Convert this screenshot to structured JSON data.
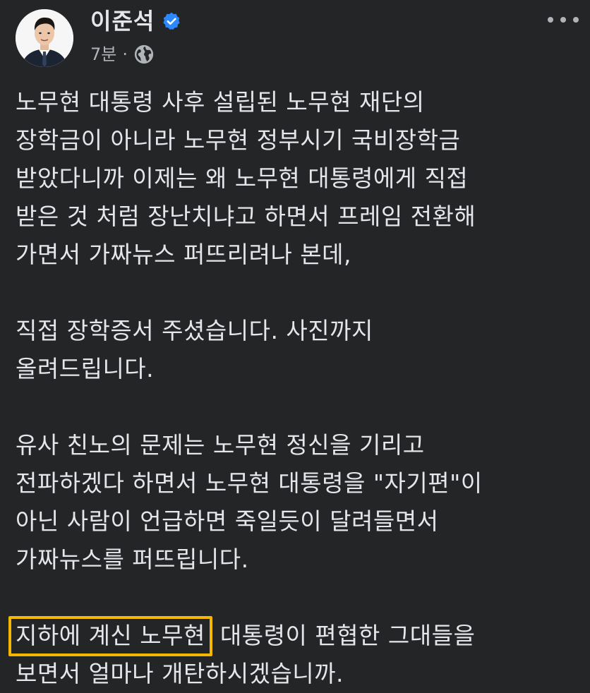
{
  "post": {
    "author": {
      "name": "이준석",
      "verified_icon": "verified-badge-icon",
      "avatar_icon": "profile-photo"
    },
    "meta": {
      "time": "7분",
      "separator": "·",
      "audience_icon": "globe-icon"
    },
    "menu_icon": "more-options-icon",
    "paragraphs": [
      {
        "lines": [
          "노무현 대통령 사후 설립된 노무현 재단의",
          "장학금이 아니라 노무현 정부시기 국비장학금",
          "받았다니까 이제는 왜 노무현 대통령에게 직접",
          "받은 것 처럼 장난치냐고 하면서 프레임 전환해",
          "가면서 가짜뉴스 퍼뜨리려나 본데,"
        ]
      },
      {
        "lines": [
          "직접 장학증서 주셨습니다. 사진까지",
          "올려드립니다."
        ]
      },
      {
        "lines": [
          "유사 친노의 문제는 노무현 정신을 기리고",
          "전파하겠다 하면서 노무현 대통령을 \"자기편\"이",
          "아닌 사람이 언급하면 죽일듯이 달려들면서",
          "가짜뉴스를 퍼뜨립니다."
        ]
      }
    ],
    "final": {
      "highlighted": "지하에 계신 노무현",
      "rest_line1": " 대통령이 편협한 그대들을",
      "line2": "보면서 얼마나 개탄하시겠습니까."
    },
    "colors": {
      "background": "#242526",
      "text": "#e4e6eb",
      "secondary_text": "#b0b3b8",
      "verified": "#2d88ff",
      "highlight_border": "#f5b800"
    }
  }
}
